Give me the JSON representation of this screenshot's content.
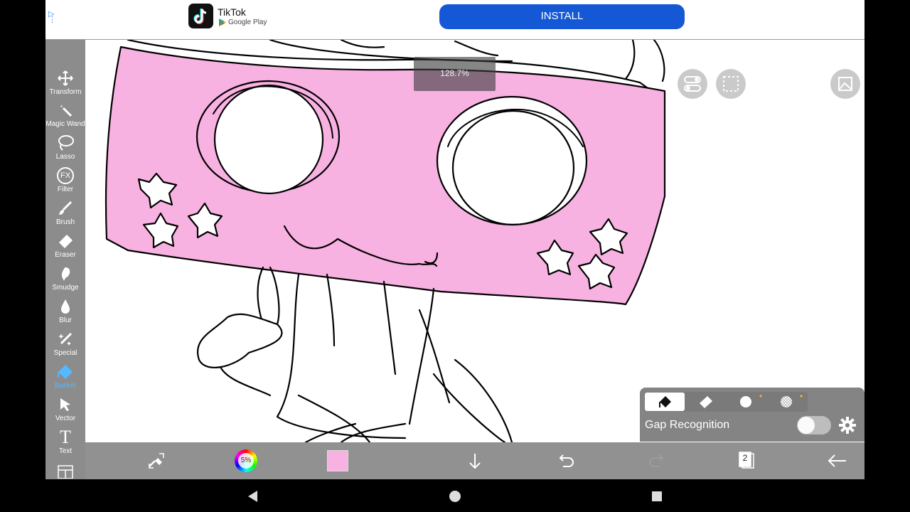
{
  "ad": {
    "app_name": "TikTok",
    "store_label": "Google Play",
    "install_label": "INSTALL"
  },
  "zoom": {
    "value": "128.7%"
  },
  "toolbar": {
    "tools": [
      {
        "label": "Transform"
      },
      {
        "label": "Magic Wand"
      },
      {
        "label": "Lasso"
      },
      {
        "label": "Filter",
        "icon_text": "FX"
      },
      {
        "label": "Brush"
      },
      {
        "label": "Eraser"
      },
      {
        "label": "Smudge"
      },
      {
        "label": "Blur"
      },
      {
        "label": "Special"
      },
      {
        "label": "Bucket",
        "active": true
      },
      {
        "label": "Vector"
      },
      {
        "label": "Text",
        "icon_text": "T"
      }
    ]
  },
  "bottom": {
    "brush_size": "5%",
    "layer_count": "2",
    "current_color": "#f8b2e1"
  },
  "bucket_panel": {
    "gap_label": "Gap Recognition",
    "gap_enabled": false
  },
  "colors": {
    "canvas_pink": "#f8b2e1",
    "accent": "#56b8ff",
    "install_blue": "#1558d6"
  }
}
